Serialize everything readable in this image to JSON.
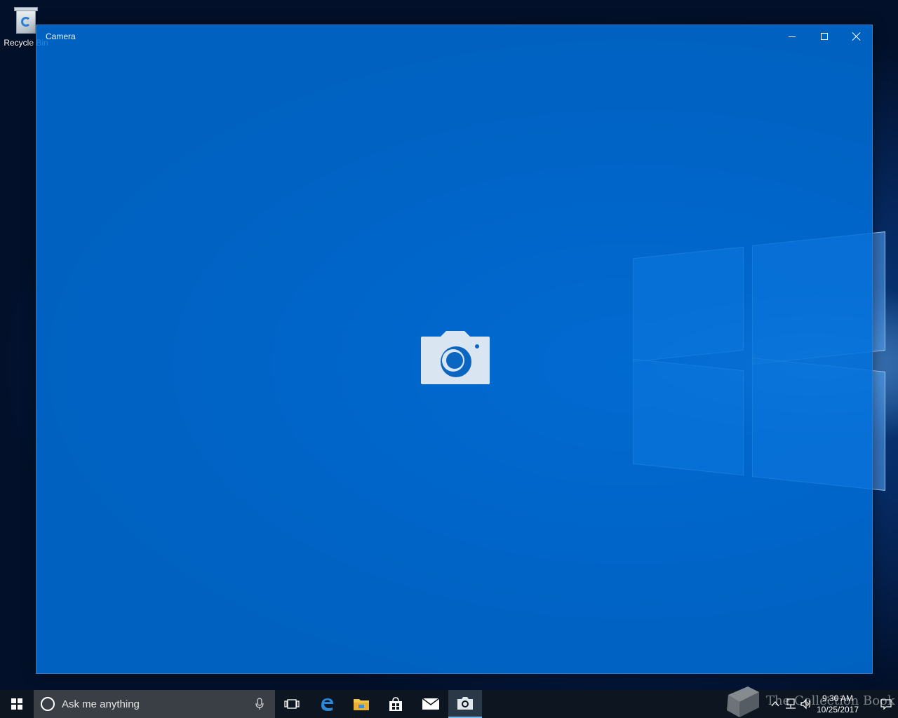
{
  "desktop": {
    "icons": [
      {
        "label": "Recycle Bin",
        "icon": "recycle-bin-icon"
      }
    ]
  },
  "window": {
    "title": "Camera",
    "controls": [
      "minimize",
      "maximize",
      "close"
    ],
    "splash_icon": "camera-icon",
    "background_color": "#0070d8"
  },
  "taskbar": {
    "search_placeholder": "Ask me anything",
    "pinned": [
      {
        "name": "task-view",
        "icon": "task-view-icon"
      },
      {
        "name": "edge",
        "icon": "edge-icon"
      },
      {
        "name": "file-explorer",
        "icon": "folder-icon"
      },
      {
        "name": "store",
        "icon": "store-icon"
      },
      {
        "name": "mail",
        "icon": "mail-icon"
      },
      {
        "name": "camera",
        "icon": "camera-icon",
        "active": true
      }
    ],
    "clock": {
      "time": "9:30 AM",
      "date": "10/25/2017"
    }
  },
  "watermark": {
    "text": "The Collection Book"
  }
}
